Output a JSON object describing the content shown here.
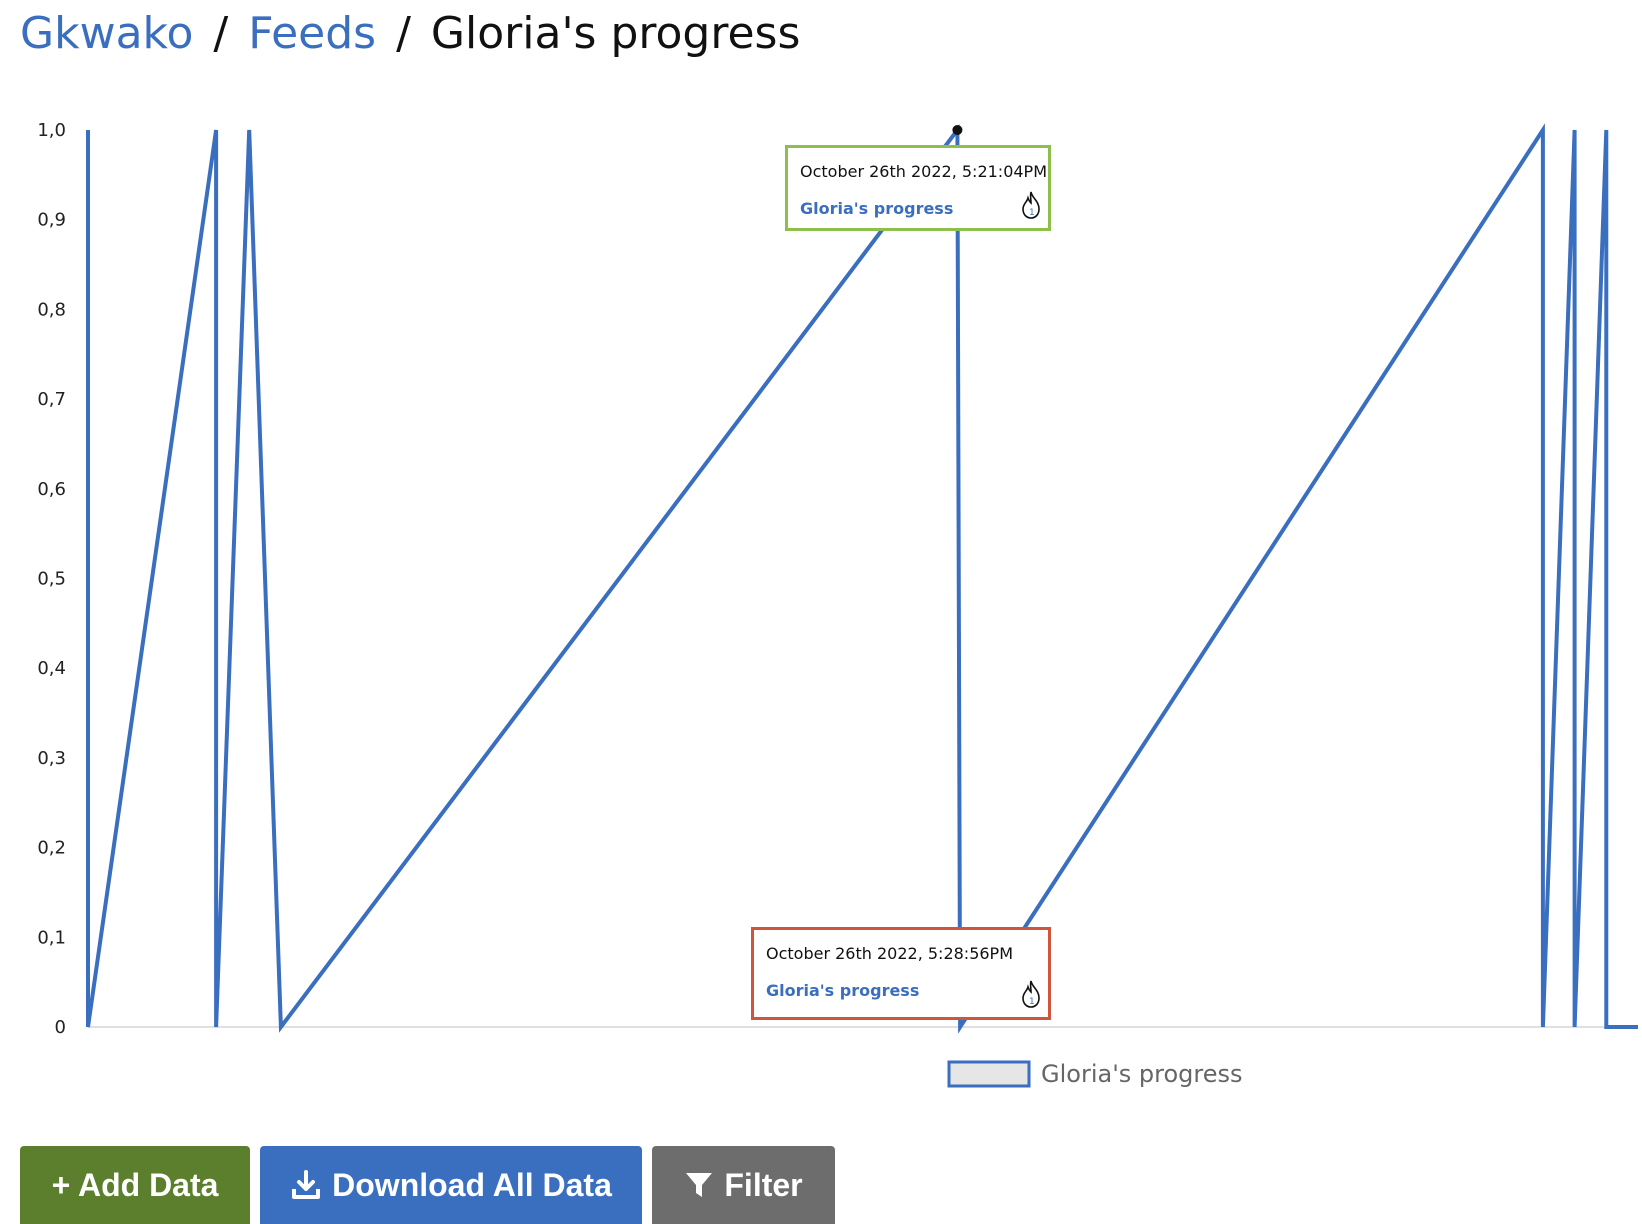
{
  "breadcrumb": {
    "home": "Gkwako",
    "sep1": "/",
    "feeds": "Feeds",
    "sep2": "/",
    "current": "Gloria's progress"
  },
  "colors": {
    "line": "#3a6ebf",
    "add_button": "#5b7f2c",
    "download_button": "#3a6ebf",
    "filter_button": "#6d6d6d",
    "tooltip_green": "#8cc04a",
    "tooltip_red": "#d0553a"
  },
  "chart_data": {
    "type": "line",
    "title": "",
    "xlabel": "",
    "ylabel": "",
    "ylim": [
      0,
      1
    ],
    "yticks": [
      "0",
      "0,1",
      "0,2",
      "0,3",
      "0,4",
      "0,5",
      "0,6",
      "0,7",
      "0,8",
      "0,9",
      "1,0"
    ],
    "x_labels_shown": false,
    "series": [
      {
        "name": "Gloria's progress",
        "points": [
          {
            "x": 0,
            "y": 1
          },
          {
            "x": 0,
            "y": 0
          },
          {
            "x": 93,
            "y": 1
          },
          {
            "x": 93,
            "y": 0
          },
          {
            "x": 117,
            "y": 1
          },
          {
            "x": 140,
            "y": 0
          },
          {
            "x": 631,
            "y": 1
          },
          {
            "x": 633,
            "y": 0
          },
          {
            "x": 1056,
            "y": 1
          },
          {
            "x": 1056,
            "y": 0
          },
          {
            "x": 1079,
            "y": 1
          },
          {
            "x": 1079,
            "y": 0
          },
          {
            "x": 1102,
            "y": 1
          },
          {
            "x": 1102,
            "y": 0
          },
          {
            "x": 1125,
            "y": 0
          }
        ]
      }
    ],
    "legend": {
      "label": "Gloria's progress",
      "position": "bottom"
    }
  },
  "tooltips": [
    {
      "date": "October 26th 2022, 5:21:04PM",
      "series": "Gloria's progress",
      "icon": "flame-icon"
    },
    {
      "date": "October 26th 2022, 5:28:56PM",
      "series": "Gloria's progress",
      "icon": "flame-icon"
    }
  ],
  "buttons": {
    "add": "+ Add Data",
    "download": "Download All Data",
    "filter": "Filter"
  }
}
